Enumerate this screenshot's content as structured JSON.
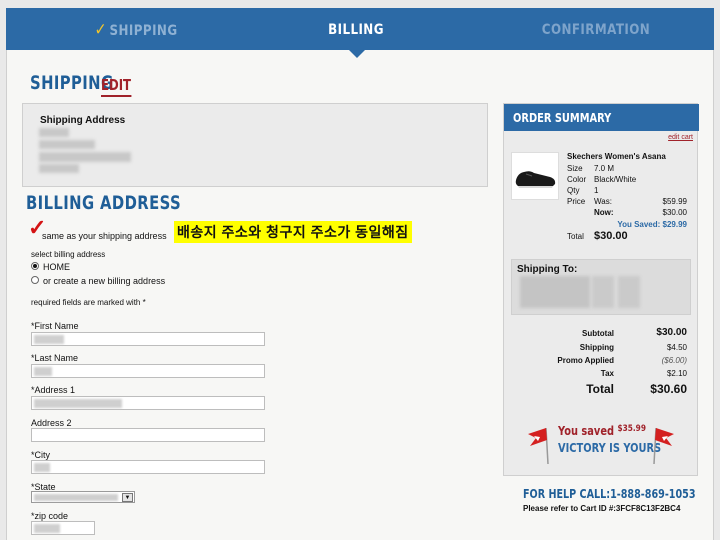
{
  "steps": {
    "shipping": "SHIPPING",
    "billing": "BILLING",
    "confirmation": "CONFIRMATION"
  },
  "shipping_section": {
    "title": "SHIPPING",
    "edit": "EDIT",
    "box_label": "Shipping Address"
  },
  "billing": {
    "title": "BILLING ADDRESS",
    "same_as_shipping": "same as your shipping address",
    "annotation": "배송지 주소와 청구지 주소가 동일해짐",
    "select_label": "select billing address",
    "option_home": "HOME",
    "option_new": "or create a new billing address",
    "required_note": "required fields are marked with *",
    "fields": {
      "first_name": "*First Name",
      "last_name": "*Last Name",
      "address1": "*Address 1",
      "address2": "Address 2",
      "city": "*City",
      "state": "*State",
      "zip": "*zip code"
    }
  },
  "summary": {
    "title": "ORDER SUMMARY",
    "edit_cart": "edit cart",
    "product_name": "Skechers Women's Asana",
    "size_label": "Size",
    "size_value": "7.0 M",
    "color_label": "Color",
    "color_value": "Black/White",
    "qty_label": "Qty",
    "qty_value": "1",
    "price_label": "Price",
    "was_label": "Was:",
    "was_value": "$59.99",
    "now_label": "Now:",
    "now_value": "$30.00",
    "you_saved": "You Saved: $29.99",
    "total_label": "Total",
    "total_value": "$30.00",
    "ship_to_label": "Shipping To:",
    "subtotal_label": "Subtotal",
    "subtotal_value": "$30.00",
    "shipping_label": "Shipping",
    "shipping_value": "$4.50",
    "promo_label": "Promo Applied",
    "promo_value": "($6.00)",
    "tax_label": "Tax",
    "tax_value": "$2.10",
    "grand_total_label": "Total",
    "grand_total_value": "$30.60",
    "saved_prefix": "You saved ",
    "saved_amount": "$35.99",
    "victory": "VICTORY IS YOURS"
  },
  "help": {
    "phone_line": "FOR HELP CALL:1-888-869-1053",
    "cart_id": "Please refer to Cart ID #:3FCF8C13F2BC4"
  },
  "colors": {
    "brand_blue": "#2c6aa6",
    "accent_red": "#a0222a",
    "highlight_yellow": "#ffff00"
  }
}
